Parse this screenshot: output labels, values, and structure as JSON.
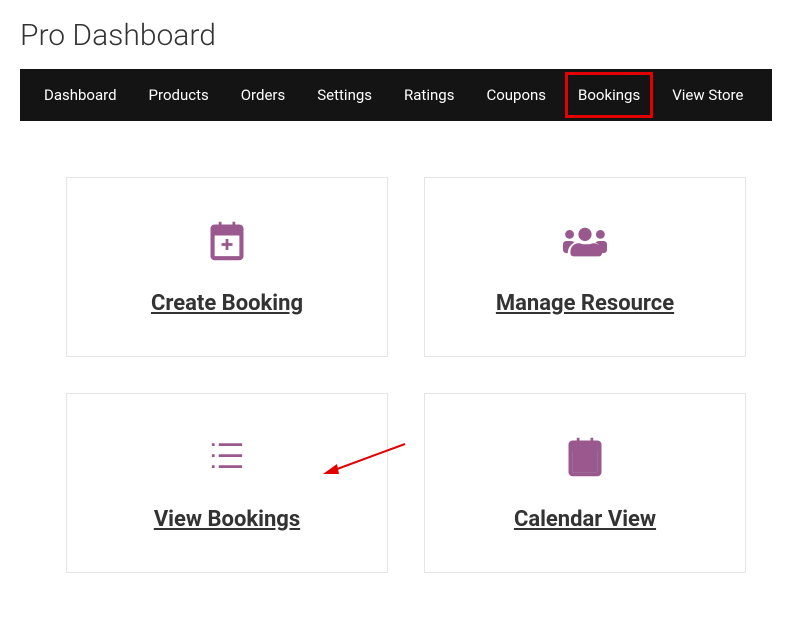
{
  "header": {
    "title": "Pro Dashboard"
  },
  "nav": {
    "items": [
      {
        "label": "Dashboard",
        "highlighted": false
      },
      {
        "label": "Products",
        "highlighted": false
      },
      {
        "label": "Orders",
        "highlighted": false
      },
      {
        "label": "Settings",
        "highlighted": false
      },
      {
        "label": "Ratings",
        "highlighted": false
      },
      {
        "label": "Coupons",
        "highlighted": false
      },
      {
        "label": "Bookings",
        "highlighted": true
      },
      {
        "label": "View Store",
        "highlighted": false
      }
    ]
  },
  "cards": {
    "create_booking": {
      "label": "Create Booking"
    },
    "manage_resource": {
      "label": "Manage Resource"
    },
    "view_bookings": {
      "label": "View Bookings"
    },
    "calendar_view": {
      "label": "Calendar View"
    }
  },
  "accent_color": "#99588e"
}
